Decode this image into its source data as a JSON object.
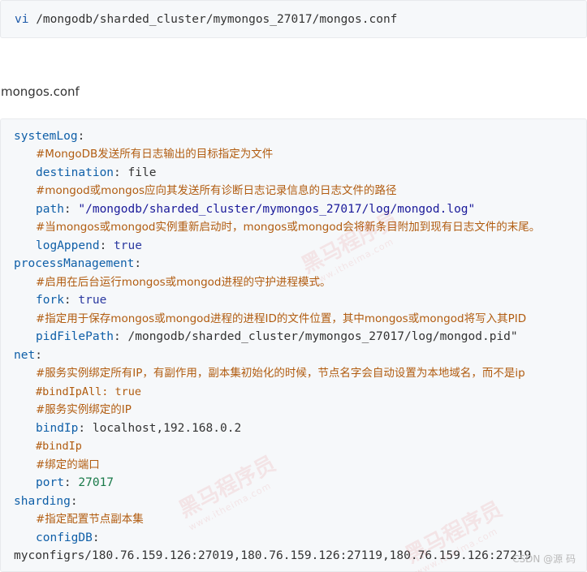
{
  "command_block": {
    "keyword": "vi",
    "path": " /mongodb/sharded_cluster/mymongos_27017/mongos.conf"
  },
  "caption": "mongos.conf",
  "config": {
    "systemLog_key": "systemLog",
    "comment_destination": "#MongoDB发送所有日志输出的目标指定为文件",
    "destination_key": "destination",
    "destination_value": "file",
    "comment_path": "#mongod或mongos应向其发送所有诊断日志记录信息的日志文件的路径",
    "path_key": "path",
    "path_value": "\"/mongodb/sharded_cluster/mymongos_27017/log/mongod.log\"",
    "comment_logAppend": "#当mongos或mongod实例重新启动时，mongos或mongod会将新条目附加到现有日志文件的末尾。",
    "logAppend_key": "logAppend",
    "logAppend_value": "true",
    "processManagement_key": "processManagement",
    "comment_fork": "#启用在后台运行mongos或mongod进程的守护进程模式。",
    "fork_key": "fork",
    "fork_value": "true",
    "comment_pidFilePath": "#指定用于保存mongos或mongod进程的进程ID的文件位置，其中mongos或mongod将写入其PID",
    "pidFilePath_key": "pidFilePath",
    "pidFilePath_value": "/mongodb/sharded_cluster/mymongos_27017/log/mongod.pid\"",
    "net_key": "net",
    "comment_net": "#服务实例绑定所有IP，有副作用，副本集初始化的时候，节点名字会自动设置为本地域名，而不是ip",
    "comment_bindIpAll": "#bindIpAll: true",
    "comment_bindIp_desc": "#服务实例绑定的IP",
    "bindIp_key": "bindIp",
    "bindIp_value": "localhost,192.168.0.2",
    "comment_bindIp": "#bindIp",
    "comment_port": "#绑定的端口",
    "port_key": "port",
    "port_value": "27017",
    "sharding_key": "sharding",
    "comment_sharding": "#指定配置节点副本集",
    "configDB_key": "configDB",
    "configDB_value": "myconfigrs/180.76.159.126:27019,180.76.159.126:27119,180.76.159.126:27219"
  },
  "watermark": {
    "main": "黑马程序员",
    "sub": "www.itheima.com"
  },
  "footer_mark": "CSDN @源  码"
}
